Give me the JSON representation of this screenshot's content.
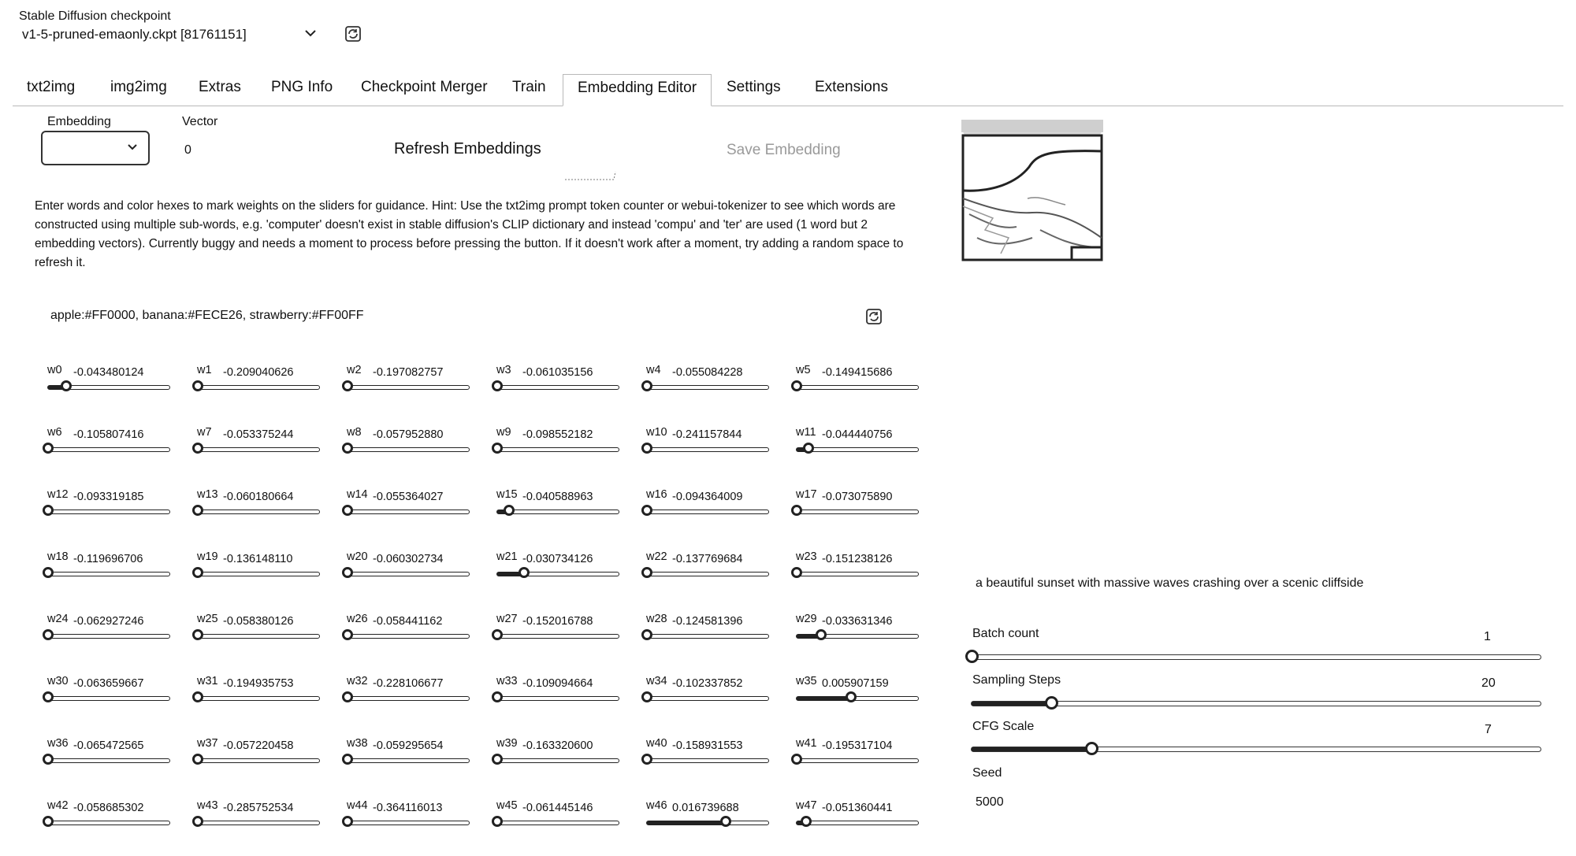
{
  "checkpoint": {
    "label": "Stable Diffusion checkpoint",
    "value": "v1-5-pruned-emaonly.ckpt [81761151]"
  },
  "tabs": [
    {
      "label": "txt2img"
    },
    {
      "label": "img2img"
    },
    {
      "label": "Extras"
    },
    {
      "label": "PNG Info"
    },
    {
      "label": "Checkpoint Merger"
    },
    {
      "label": "Train"
    },
    {
      "label": "Embedding Editor",
      "active": true
    },
    {
      "label": "Settings"
    },
    {
      "label": "Extensions"
    }
  ],
  "editor": {
    "embedding_label": "Embedding",
    "embedding_value": "",
    "vector_label": "Vector",
    "vector_value": "0",
    "refresh_label": "Refresh Embeddings",
    "save_label": "Save Embedding",
    "help_text": "Enter words and color hexes to mark weights on the sliders for guidance. Hint: Use the txt2img prompt token counter or webui-tokenizer to see which words are constructed using multiple sub-words, e.g. 'computer' doesn't exist in stable diffusion's CLIP dictionary and instead 'compu' and 'ter' are used (1 word but 2 embedding vectors). Currently buggy and needs a moment to process before pressing the button. If it doesn't work after a moment, try adding a random space to refresh it.",
    "color_hints": "apple:#FF0000, banana:#FECE26, strawberry:#FF00FF"
  },
  "weights": [
    {
      "label": "w0",
      "value": "-0.043480124",
      "level": 0.15
    },
    {
      "label": "w1",
      "value": "-0.209040626",
      "level": 0
    },
    {
      "label": "w2",
      "value": "-0.197082757",
      "level": 0
    },
    {
      "label": "w3",
      "value": "-0.061035156",
      "level": 0
    },
    {
      "label": "w4",
      "value": "-0.055084228",
      "level": 0
    },
    {
      "label": "w5",
      "value": "-0.149415686",
      "level": 0
    },
    {
      "label": "w6",
      "value": "-0.105807416",
      "level": 0
    },
    {
      "label": "w7",
      "value": "-0.053375244",
      "level": 0
    },
    {
      "label": "w8",
      "value": "-0.057952880",
      "level": 0
    },
    {
      "label": "w9",
      "value": "-0.098552182",
      "level": 0
    },
    {
      "label": "w10",
      "value": "-0.241157844",
      "level": 0
    },
    {
      "label": "w11",
      "value": "-0.044440756",
      "level": 0.1
    },
    {
      "label": "w12",
      "value": "-0.093319185",
      "level": 0
    },
    {
      "label": "w13",
      "value": "-0.060180664",
      "level": 0
    },
    {
      "label": "w14",
      "value": "-0.055364027",
      "level": 0
    },
    {
      "label": "w15",
      "value": "-0.040588963",
      "level": 0.1
    },
    {
      "label": "w16",
      "value": "-0.094364009",
      "level": 0
    },
    {
      "label": "w17",
      "value": "-0.073075890",
      "level": 0
    },
    {
      "label": "w18",
      "value": "-0.119696706",
      "level": 0
    },
    {
      "label": "w19",
      "value": "-0.136148110",
      "level": 0
    },
    {
      "label": "w20",
      "value": "-0.060302734",
      "level": 0
    },
    {
      "label": "w21",
      "value": "-0.030734126",
      "level": 0.22
    },
    {
      "label": "w22",
      "value": "-0.137769684",
      "level": 0
    },
    {
      "label": "w23",
      "value": "-0.151238126",
      "level": 0
    },
    {
      "label": "w24",
      "value": "-0.062927246",
      "level": 0
    },
    {
      "label": "w25",
      "value": "-0.058380126",
      "level": 0
    },
    {
      "label": "w26",
      "value": "-0.058441162",
      "level": 0
    },
    {
      "label": "w27",
      "value": "-0.152016788",
      "level": 0
    },
    {
      "label": "w28",
      "value": "-0.124581396",
      "level": 0
    },
    {
      "label": "w29",
      "value": "-0.033631346",
      "level": 0.2
    },
    {
      "label": "w30",
      "value": "-0.063659667",
      "level": 0
    },
    {
      "label": "w31",
      "value": "-0.194935753",
      "level": 0
    },
    {
      "label": "w32",
      "value": "-0.228106677",
      "level": 0
    },
    {
      "label": "w33",
      "value": "-0.109094664",
      "level": 0
    },
    {
      "label": "w34",
      "value": "-0.102337852",
      "level": 0
    },
    {
      "label": "w35",
      "value": "0.005907159",
      "level": 0.45
    },
    {
      "label": "w36",
      "value": "-0.065472565",
      "level": 0
    },
    {
      "label": "w37",
      "value": "-0.057220458",
      "level": 0
    },
    {
      "label": "w38",
      "value": "-0.059295654",
      "level": 0
    },
    {
      "label": "w39",
      "value": "-0.163320600",
      "level": 0
    },
    {
      "label": "w40",
      "value": "-0.158931553",
      "level": 0
    },
    {
      "label": "w41",
      "value": "-0.195317104",
      "level": 0
    },
    {
      "label": "w42",
      "value": "-0.058685302",
      "level": 0
    },
    {
      "label": "w43",
      "value": "-0.285752534",
      "level": 0
    },
    {
      "label": "w44",
      "value": "-0.364116013",
      "level": 0
    },
    {
      "label": "w45",
      "value": "-0.061445146",
      "level": 0
    },
    {
      "label": "w46",
      "value": "0.016739688",
      "level": 0.65
    },
    {
      "label": "w47",
      "value": "-0.051360441",
      "level": 0.08
    }
  ],
  "generation": {
    "prompt": "a beautiful sunset with massive waves crashing over a scenic cliffside",
    "batch_count_label": "Batch count",
    "batch_count_value": "1",
    "batch_count_level": 0,
    "sampling_steps_label": "Sampling Steps",
    "sampling_steps_value": "20",
    "sampling_steps_level": 0.14,
    "cfg_scale_label": "CFG Scale",
    "cfg_scale_value": "7",
    "cfg_scale_level": 0.21,
    "seed_label": "Seed",
    "seed_value": "5000"
  }
}
